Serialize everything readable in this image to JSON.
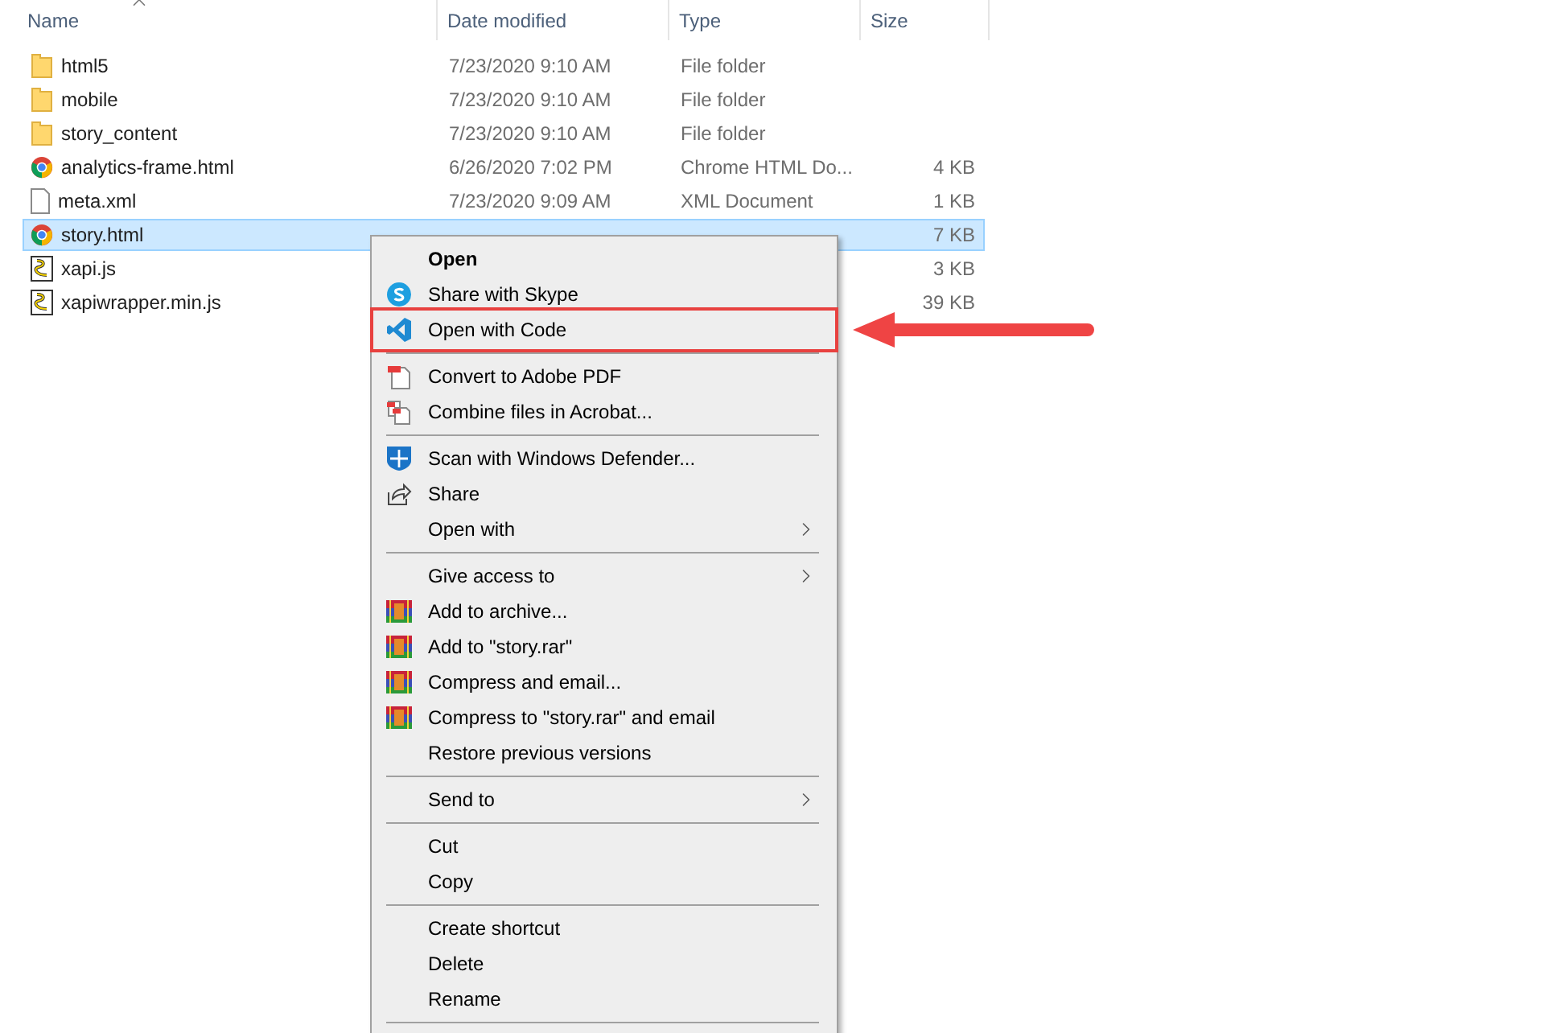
{
  "file_list": {
    "columns": [
      {
        "label": "Name",
        "sorted": true
      },
      {
        "label": "Date modified",
        "sorted": false
      },
      {
        "label": "Type",
        "sorted": false
      },
      {
        "label": "Size",
        "sorted": false
      }
    ],
    "rows": [
      {
        "kind": "folder",
        "name": "html5",
        "date": "7/23/2020 9:10 AM",
        "type": "File folder",
        "selected": false
      },
      {
        "kind": "folder",
        "name": "mobile",
        "date": "7/23/2020 9:10 AM",
        "type": "File folder",
        "selected": false
      },
      {
        "kind": "folder",
        "name": "story_content",
        "date": "7/23/2020 9:10 AM",
        "type": "File folder",
        "selected": false
      },
      {
        "kind": "chrome",
        "name": "analytics-frame.html",
        "date": "6/26/2020 7:02 PM",
        "type": "Chrome HTML Do...",
        "size": "4 KB",
        "selected": false
      },
      {
        "kind": "file",
        "name": "meta.xml",
        "date": "7/23/2020 9:09 AM",
        "type": "XML Document",
        "size": "1 KB",
        "selected": false
      },
      {
        "kind": "chrome",
        "name": "story.html",
        "size": "7 KB",
        "selected": true
      },
      {
        "kind": "script",
        "name": "xapi.js",
        "size": "3 KB",
        "selected": false
      },
      {
        "kind": "script",
        "name": "xapiwrapper.min.js",
        "size": "39 KB",
        "selected": false
      }
    ]
  },
  "context_menu": {
    "items": [
      {
        "kind": "default",
        "label": "Open",
        "highlighted": false,
        "submenu": false
      },
      {
        "kind": "skype",
        "label": "Share with Skype",
        "highlighted": false,
        "submenu": false
      },
      {
        "kind": "vscode",
        "label": "Open with Code",
        "highlighted": true,
        "submenu": false
      },
      {
        "kind": "separator"
      },
      {
        "kind": "pdf",
        "label": "Convert to Adobe PDF",
        "highlighted": false,
        "submenu": false
      },
      {
        "kind": "acrobat",
        "label": "Combine files in Acrobat...",
        "highlighted": false,
        "submenu": false
      },
      {
        "kind": "separator"
      },
      {
        "kind": "defender",
        "label": "Scan with Windows Defender...",
        "highlighted": false,
        "submenu": false
      },
      {
        "kind": "share",
        "label": "Share",
        "highlighted": false,
        "submenu": false
      },
      {
        "kind": "plain",
        "label": "Open with",
        "highlighted": false,
        "submenu": true
      },
      {
        "kind": "separator"
      },
      {
        "kind": "plain",
        "label": "Give access to",
        "highlighted": false,
        "submenu": true
      },
      {
        "kind": "winrar",
        "label": "Add to archive...",
        "highlighted": false,
        "submenu": false
      },
      {
        "kind": "winrar",
        "label": "Add to \"story.rar\"",
        "highlighted": false,
        "submenu": false
      },
      {
        "kind": "winrar",
        "label": "Compress and email...",
        "highlighted": false,
        "submenu": false
      },
      {
        "kind": "winrar",
        "label": "Compress to \"story.rar\" and email",
        "highlighted": false,
        "submenu": false
      },
      {
        "kind": "plain",
        "label": "Restore previous versions",
        "highlighted": false,
        "submenu": false
      },
      {
        "kind": "separator"
      },
      {
        "kind": "plain",
        "label": "Send to",
        "highlighted": false,
        "submenu": true
      },
      {
        "kind": "separator"
      },
      {
        "kind": "plain",
        "label": "Cut",
        "highlighted": false,
        "submenu": false
      },
      {
        "kind": "plain",
        "label": "Copy",
        "highlighted": false,
        "submenu": false
      },
      {
        "kind": "separator"
      },
      {
        "kind": "plain",
        "label": "Create shortcut",
        "highlighted": false,
        "submenu": false
      },
      {
        "kind": "plain",
        "label": "Delete",
        "highlighted": false,
        "submenu": false
      },
      {
        "kind": "plain",
        "label": "Rename",
        "highlighted": false,
        "submenu": false
      },
      {
        "kind": "separator"
      }
    ]
  }
}
